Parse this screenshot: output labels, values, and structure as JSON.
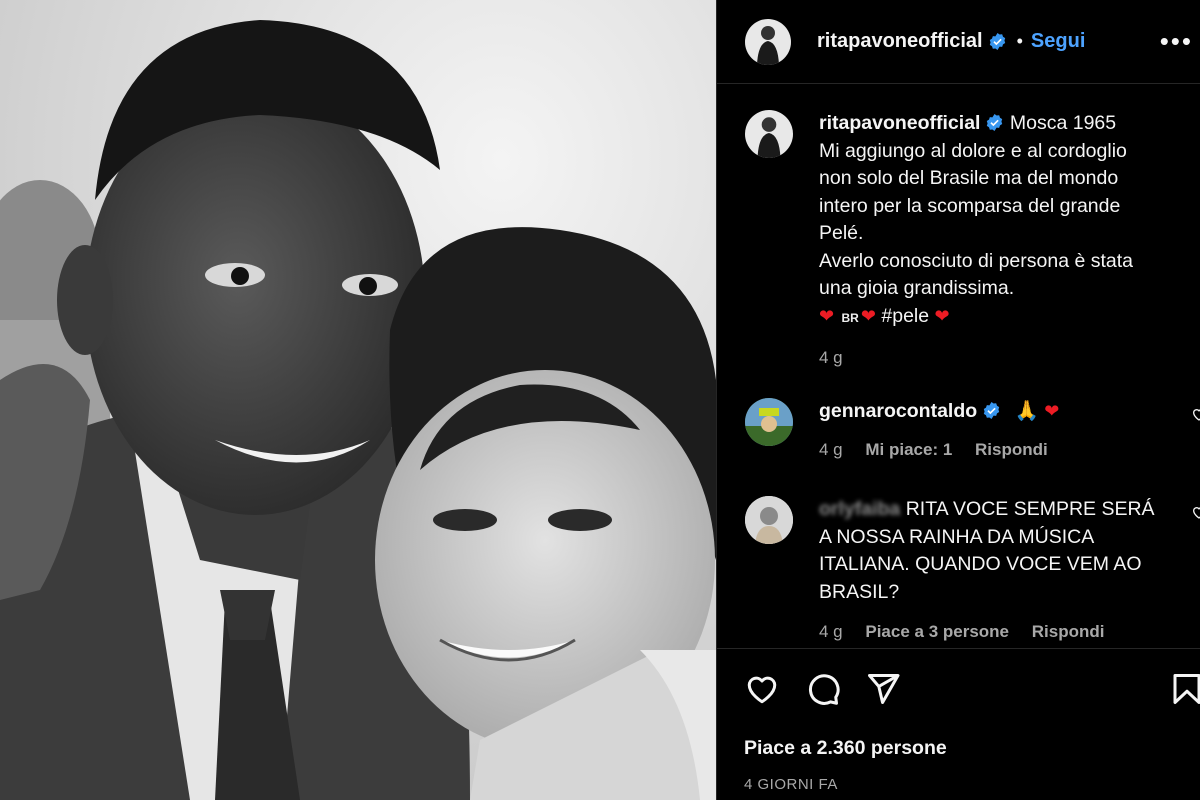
{
  "post": {
    "account": "ritapavoneofficial",
    "follow_label": "Segui",
    "dot": "•",
    "more": "•••"
  },
  "caption": {
    "username": "ritapavoneofficial",
    "lines": [
      "Mosca 1965",
      "Mi aggiungo al dolore e al cordoglio",
      "non solo del Brasile ma del mondo",
      "intero per la scomparsa del grande",
      "Pelé.",
      "Averlo conosciuto di persona è stata",
      "una gioia grandissima."
    ],
    "emoji_heart": "❤",
    "flag": "BR",
    "hashtag": "#pele",
    "time": "4 g"
  },
  "comments": [
    {
      "username": "gennarocontaldo",
      "text_emoji_pray": "🙏",
      "text_emoji_heart": "❤",
      "time": "4 g",
      "likes": "Mi piace: 1",
      "reply": "Rispondi"
    },
    {
      "username": "orlyfaiba",
      "lines": [
        "RITA VOCE SEMPRE SERÁ",
        "A NOSSA RAINHA DA MÚSICA",
        "ITALIANA. QUANDO VOCE VEM AO",
        "BRASIL?"
      ],
      "time": "4 g",
      "likes": "Piace a 3 persone",
      "reply": "Rispondi"
    }
  ],
  "footer": {
    "likes": "Piace a 2.360 persone",
    "date": "4 GIORNI FA"
  },
  "icons": {
    "like": "heart-icon",
    "comment": "comment-icon",
    "share": "share-icon",
    "save": "bookmark-icon",
    "verified": "verified-badge-icon"
  },
  "colors": {
    "background": "#000000",
    "link": "#4da3ff",
    "muted": "#a8a8a8",
    "verified": "#3897f0",
    "heart": "#ed1c24"
  }
}
